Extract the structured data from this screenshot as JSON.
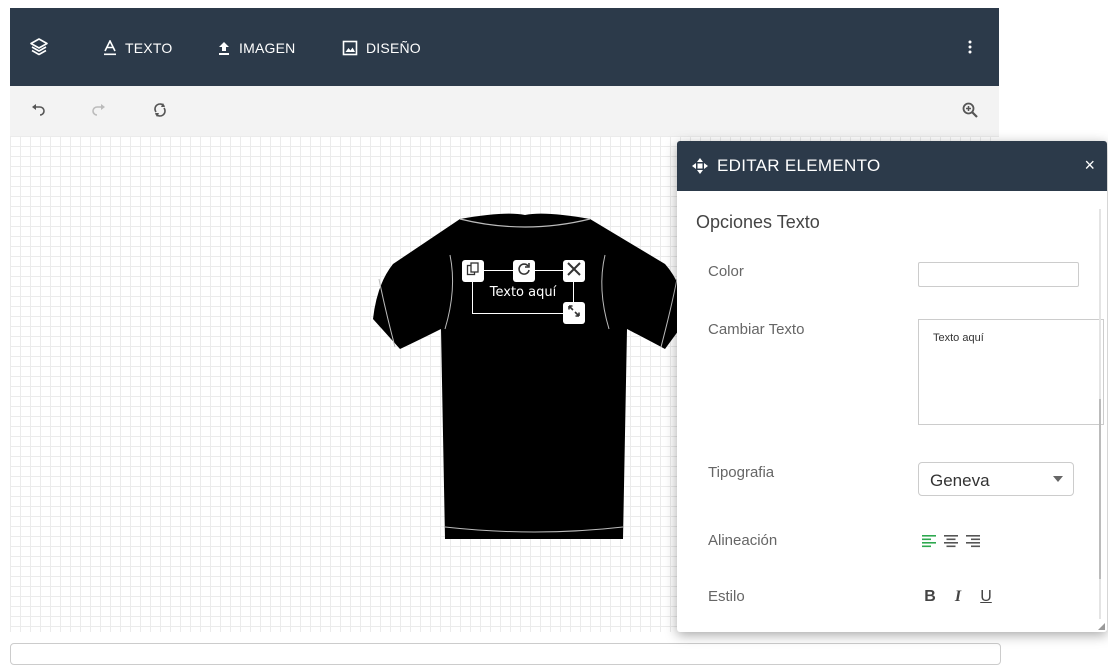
{
  "topbar": {
    "texto_label": "TEXTO",
    "imagen_label": "IMAGEN",
    "diseno_label": "DISEÑO"
  },
  "canvas": {
    "element_text": "Texto aquí"
  },
  "panel": {
    "title": "EDITAR ELEMENTO",
    "close": "×",
    "section_title": "Opciones Texto",
    "color_label": "Color",
    "color_value": "",
    "change_text_label": "Cambiar Texto",
    "change_text_value": "Texto aquí",
    "font_label": "Tipografia",
    "font_value": "Geneva",
    "align_label": "Alineación",
    "style_label": "Estilo",
    "style_bold": "B",
    "style_italic": "I",
    "style_underline": "U"
  },
  "colors": {
    "header": "#2c3a4a",
    "accent_active": "#2ea84f"
  }
}
